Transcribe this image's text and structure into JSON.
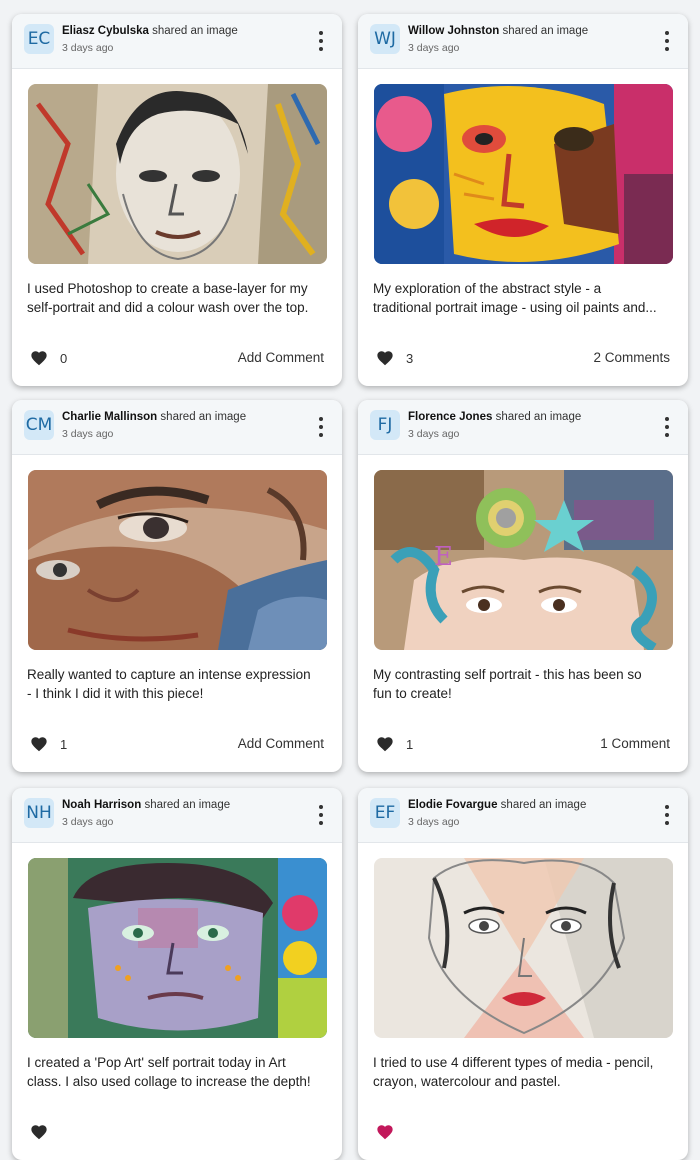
{
  "shared_text": "shared an image",
  "posts": [
    {
      "initials": "EC",
      "author": "Eliasz Cybulska",
      "time": "3 days ago",
      "caption": [
        "I used Photoshop to create a base-layer for my",
        "self-portrait and did a colour wash over the top."
      ],
      "likes": "0",
      "comments": "Add Comment",
      "heart_color": "#2b2b2b"
    },
    {
      "initials": "WJ",
      "author": "Willow Johnston",
      "time": "3 days ago",
      "caption": [
        "My exploration of the abstract style - a",
        "traditional portrait image - using oil paints and..."
      ],
      "likes": "3",
      "comments": "2 Comments",
      "heart_color": "#2b2b2b"
    },
    {
      "initials": "CM",
      "author": "Charlie Mallinson",
      "time": "3 days ago",
      "caption": [
        "Really wanted to capture an intense expression",
        "- I think I did it with this piece!"
      ],
      "likes": "1",
      "comments": "Add Comment",
      "heart_color": "#2b2b2b"
    },
    {
      "initials": "FJ",
      "author": "Florence Jones",
      "time": "3 days ago",
      "caption": [
        "My contrasting self portrait - this has been so",
        "fun to create!"
      ],
      "likes": "1",
      "comments": "1 Comment",
      "heart_color": "#2b2b2b"
    },
    {
      "initials": "NH",
      "author": "Noah Harrison",
      "time": "3 days ago",
      "caption": [
        "I created a 'Pop Art' self portrait today in Art",
        "class. I also used collage to increase the depth!"
      ],
      "likes": "",
      "comments": "",
      "heart_color": "#2b2b2b"
    },
    {
      "initials": "EF",
      "author": "Elodie Fovargue",
      "time": "3 days ago",
      "caption": [
        "I tried to use 4 different types of media - pencil,",
        "crayon, watercolour and pastel."
      ],
      "likes": "",
      "comments": "",
      "heart_color": "#c2185b"
    }
  ]
}
